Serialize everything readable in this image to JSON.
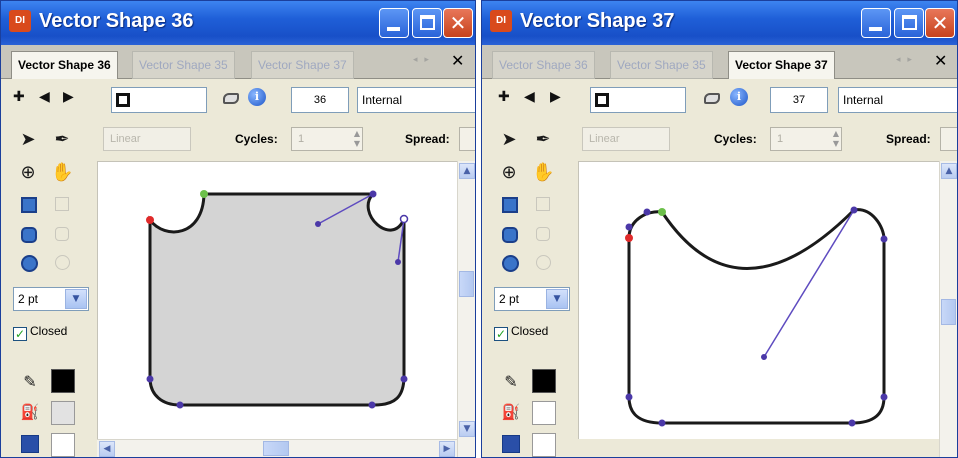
{
  "windows": [
    {
      "title": "Vector Shape 36",
      "app_icon": "DI",
      "tabs": [
        "Vector Shape 36",
        "Vector Shape 35",
        "Vector Shape 37"
      ],
      "active_tab": 0,
      "member_number": "36",
      "ink": "Internal",
      "gradient_type": "Linear",
      "cycles_label": "Cycles:",
      "cycles_value": "1",
      "spread_label": "Spread:",
      "line_width": "2 pt",
      "closed_label": "Closed",
      "closed": true,
      "fill_color": "#d4d4d4"
    },
    {
      "title": "Vector Shape 37",
      "app_icon": "DI",
      "tabs": [
        "Vector Shape 36",
        "Vector Shape 35",
        "Vector Shape 37"
      ],
      "active_tab": 2,
      "member_number": "37",
      "ink": "Internal",
      "gradient_type": "Linear",
      "cycles_label": "Cycles:",
      "cycles_value": "1",
      "spread_label": "Spread:",
      "line_width": "2 pt",
      "closed_label": "Closed",
      "closed": true,
      "fill_color": "#ffffff"
    }
  ],
  "icons": {
    "nav": [
      "plus-icon",
      "prev-arrow-icon",
      "next-arrow-icon"
    ],
    "tools": [
      "arrow-tool-icon",
      "pen-tool-icon",
      "registration-point-icon",
      "hand-tool-icon",
      "rectangle-icon",
      "rounded-rectangle-icon",
      "ellipse-icon"
    ]
  },
  "colors": {
    "title_bar": "#1f5fd8",
    "stroke": "#1a1a1a",
    "vertex": "#4b38a8",
    "handle_line": "#5e4bc0",
    "first_vertex": "#e02a2a",
    "last_vertex": "#6cc04a"
  }
}
